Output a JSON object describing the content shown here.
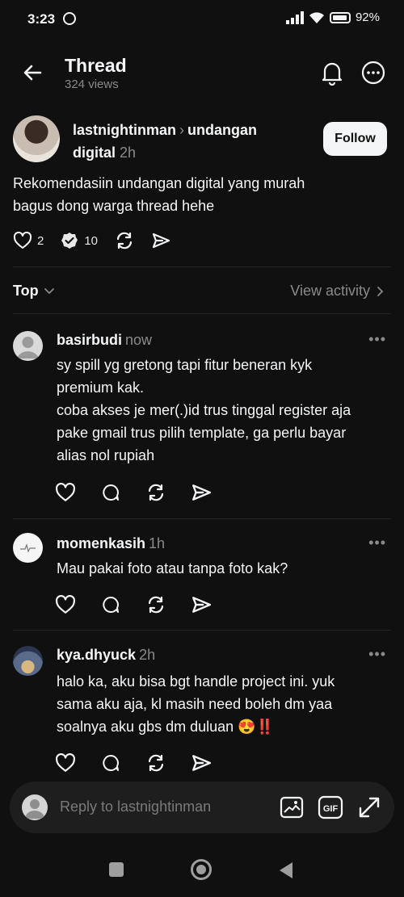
{
  "status_bar": {
    "time": "3:23",
    "battery": "92%"
  },
  "header": {
    "title": "Thread",
    "views": "324 views"
  },
  "post": {
    "author": "lastnightinman",
    "topic": "undangan digital",
    "time": "2h",
    "follow_label": "Follow",
    "text_line1": "Rekomendasiin undangan digital yang murah",
    "text_line2": "bagus dong warga thread hehe",
    "like_count": "2",
    "reply_count": "10"
  },
  "sort": {
    "label": "Top",
    "view_activity": "View activity"
  },
  "comments": [
    {
      "username": "basirbudi",
      "time": "now",
      "lines": [
        "sy spill yg gretong tapi fitur beneran kyk",
        "premium kak.",
        "coba akses je mer(.)id trus tinggal register aja",
        "pake gmail trus pilih template, ga perlu bayar",
        "alias nol rupiah"
      ]
    },
    {
      "username": "momenkasih",
      "time": "1h",
      "lines": [
        "Mau pakai foto atau tanpa foto kak?"
      ]
    },
    {
      "username": "kya.dhyuck",
      "time": "2h",
      "lines": [
        "halo ka, aku bisa bgt handle project ini. yuk",
        "sama aku aja, kl masih need boleh dm yaa",
        "soalnya aku gbs dm duluan 😍‼️"
      ]
    }
  ],
  "reply_bar": {
    "placeholder": "Reply to lastnightinman"
  },
  "icons": {
    "back": "arrow-left-icon",
    "bell": "bell-icon",
    "more": "more-circle-icon",
    "heart": "heart-icon",
    "comment": "comment-icon",
    "repost": "repost-icon",
    "share": "send-icon",
    "image": "image-icon",
    "gif": "gif-icon",
    "expand": "expand-icon"
  },
  "colors": {
    "background": "#101010",
    "text": "#f3f5f7",
    "muted": "#8a8a8a",
    "follow_bg": "#f3f5f7"
  }
}
